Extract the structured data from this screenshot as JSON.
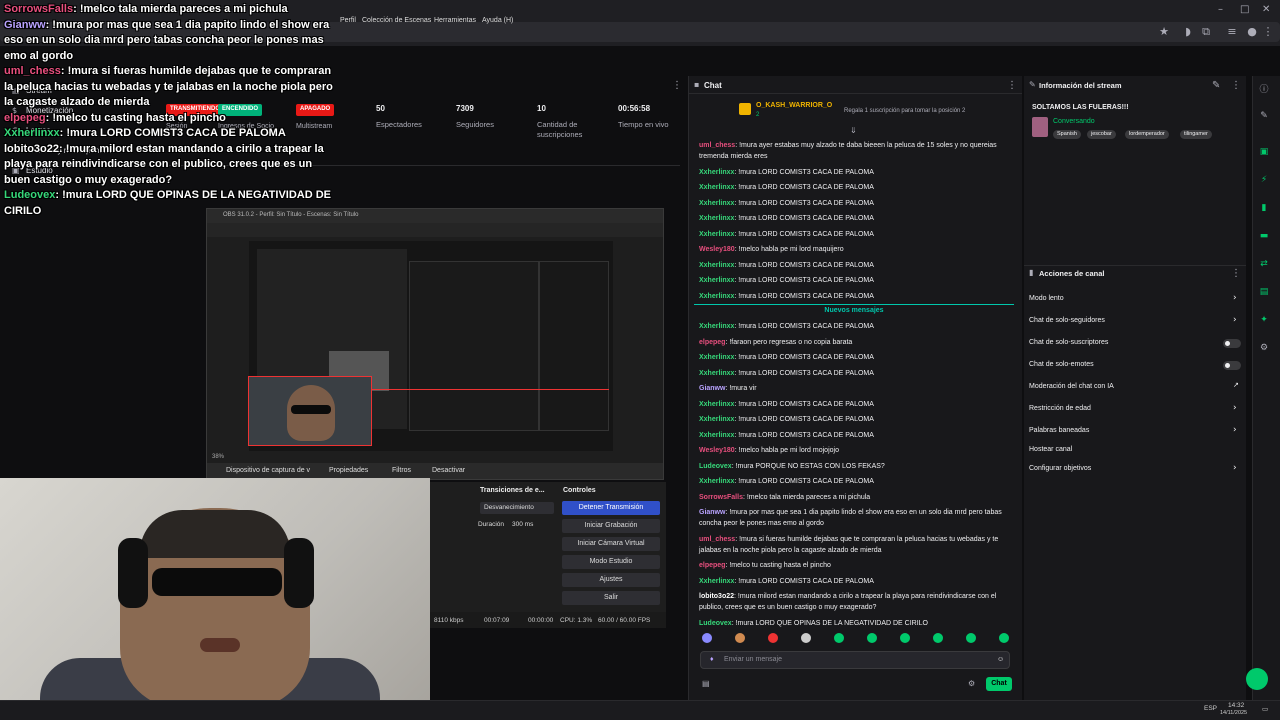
{
  "overlay_chat": [
    {
      "user": "SorrowsFalls",
      "user_color": "#e84f7e",
      "text": "!melco tala mierda pareces a mi pichula"
    },
    {
      "user": "Gianww",
      "user_color": "#b9a3ff",
      "text": "!mura por mas que sea 1 dia papito lindo el show era eso en un solo dia mrd pero tabas concha peor le pones mas emo al gordo"
    },
    {
      "user": "uml_chess",
      "user_color": "#e84f7e",
      "text": "!mura si fueras humilde dejabas que te compraran la peluca hacias tu webadas y te jalabas en la noche piola pero la cagaste alzado de mierda"
    },
    {
      "user": "elpepeg",
      "user_color": "#e84f7e",
      "text": "!melco tu casting hasta el pincho"
    },
    {
      "user": "Xxherlinxx",
      "user_color": "#36d87a",
      "text": "!mura LORD COMIST3 CACA DE PALOMA"
    },
    {
      "user": "lobito3o22",
      "user_color": "#ffffff",
      "text": "!mura milord estan mandando a cirilo a trapear la playa para reindivindicarse con el publico, crees que es un buen castigo o muy exagerado?"
    },
    {
      "user": "Ludeovex",
      "user_color": "#36d87a",
      "text": "!mura LORD QUE OPINAS DE LA NEGATIVIDAD DE CIRILO"
    }
  ],
  "nav": {
    "items": [
      "Stream",
      "Monetización",
      "Logros",
      "Premios y recompensas",
      "Estudio"
    ]
  },
  "status_badges": [
    {
      "label": "TRANSMITIENDO",
      "sub": "Sesión",
      "color": "#e91916"
    },
    {
      "label": "ENCENDIDO",
      "sub": "Ingresos de Socio",
      "color": "#00b37a"
    },
    {
      "label": "APAGADO",
      "sub": "Multistream",
      "color": "#e91916"
    }
  ],
  "stats": [
    {
      "value": "50",
      "label": "Espectadores"
    },
    {
      "value": "7309",
      "label": "Seguidores"
    },
    {
      "value": "10",
      "label": "Cantidad de suscripciones"
    },
    {
      "value": "00:56:58",
      "label": "Tiempo en vivo"
    }
  ],
  "obs": {
    "title": "OBS 31.0.2 - Perfil: Sin Título - Escenas: Sin Título",
    "menu": [
      "Perfil",
      "Colección de Escenas",
      "Herramientas",
      "Ayuda (H)"
    ],
    "zoom": "38%",
    "source_bar": [
      "Dispositivo de captura de v",
      "Propiedades",
      "Filtros",
      "Desactivar"
    ],
    "transitions_title": "Transiciones de e...",
    "transition_type": "Desvanecimiento",
    "duration_label": "Duración",
    "duration_value": "300 ms",
    "controls_title": "Controles",
    "controls": [
      "Detener Transmisión",
      "Iniciar Grabación",
      "Iniciar Cámara Virtual",
      "Modo Estudio",
      "Ajustes",
      "Salir"
    ],
    "status": [
      "8110 kbps",
      "00:07:09",
      "00:00:00",
      "CPU: 1.3%",
      "60.00 / 60.00 FPS"
    ]
  },
  "chat": {
    "title": "Chat",
    "top_gifter": "O_KASH_WARRIOR_O",
    "top_gifter_count": "2",
    "sub_banner": "Regala 1 suscripción para tomar la posición 2",
    "new_messages_label": "Nuevos mensajes",
    "messages_before": [
      {
        "user": "uml_chess",
        "color": "#e84f7e",
        "text": "!mura ayer estabas muy alzado te daba bieeen la peluca de 15 soles y no quereias tremenda mierda eres"
      },
      {
        "user": "Xxherlinxx",
        "color": "#36d87a",
        "text": "!mura LORD COMIST3 CACA DE PALOMA"
      },
      {
        "user": "Xxherlinxx",
        "color": "#36d87a",
        "text": "!mura LORD COMIST3 CACA DE PALOMA"
      },
      {
        "user": "Xxherlinxx",
        "color": "#36d87a",
        "text": "!mura LORD COMIST3 CACA DE PALOMA"
      },
      {
        "user": "Xxherlinxx",
        "color": "#36d87a",
        "text": "!mura LORD COMIST3 CACA DE PALOMA"
      },
      {
        "user": "Xxherlinxx",
        "color": "#36d87a",
        "text": "!mura LORD COMIST3 CACA DE PALOMA"
      },
      {
        "user": "Wesley180",
        "color": "#e84f7e",
        "text": "!melco habla pe mi lord maquijero"
      },
      {
        "user": "Xxherlinxx",
        "color": "#36d87a",
        "text": "!mura LORD COMIST3 CACA DE PALOMA"
      },
      {
        "user": "Xxherlinxx",
        "color": "#36d87a",
        "text": "!mura LORD COMIST3 CACA DE PALOMA"
      },
      {
        "user": "Xxherlinxx",
        "color": "#36d87a",
        "text": "!mura LORD COMIST3 CACA DE PALOMA"
      }
    ],
    "messages_after": [
      {
        "user": "Xxherlinxx",
        "color": "#36d87a",
        "text": "!mura LORD COMIST3 CACA DE PALOMA"
      },
      {
        "user": "elpepeg",
        "color": "#e84f7e",
        "text": "!faraon pero regresas o no copia barata"
      },
      {
        "user": "Xxherlinxx",
        "color": "#36d87a",
        "text": "!mura LORD COMIST3 CACA DE PALOMA"
      },
      {
        "user": "Xxherlinxx",
        "color": "#36d87a",
        "text": "!mura LORD COMIST3 CACA DE PALOMA"
      },
      {
        "user": "Gianww",
        "color": "#b9a3ff",
        "text": "!mura vir"
      },
      {
        "user": "Xxherlinxx",
        "color": "#36d87a",
        "text": "!mura LORD COMIST3 CACA DE PALOMA"
      },
      {
        "user": "Xxherlinxx",
        "color": "#36d87a",
        "text": "!mura LORD COMIST3 CACA DE PALOMA"
      },
      {
        "user": "Xxherlinxx",
        "color": "#36d87a",
        "text": "!mura LORD COMIST3 CACA DE PALOMA"
      },
      {
        "user": "Wesley180",
        "color": "#e84f7e",
        "text": "!melco habla pe mi lord mojojojo"
      },
      {
        "user": "Ludeovex",
        "color": "#36d87a",
        "text": "!mura PORQUE NO ESTAS CON LOS FEKAS?"
      },
      {
        "user": "Xxherlinxx",
        "color": "#36d87a",
        "text": "!mura LORD COMIST3 CACA DE PALOMA"
      },
      {
        "user": "SorrowsFalls",
        "color": "#e84f7e",
        "text": "!melco tala mierda pareces a mi pichula"
      },
      {
        "user": "Gianww",
        "color": "#b9a3ff",
        "text": "!mura por mas que sea 1 dia papito lindo el show era eso en un solo dia mrd pero tabas concha peor le pones mas emo al gordo"
      },
      {
        "user": "uml_chess",
        "color": "#e84f7e",
        "text": "!mura si fueras humilde dejabas que te compraran la peluca hacias tu webadas y te jalabas en la noche piola pero la cagaste alzado de mierda"
      },
      {
        "user": "elpepeg",
        "color": "#e84f7e",
        "text": "!melco tu casting hasta el pincho"
      },
      {
        "user": "Xxherlinxx",
        "color": "#36d87a",
        "text": "!mura LORD COMIST3 CACA DE PALOMA"
      },
      {
        "user": "lobito3o22",
        "color": "#ffffff",
        "text": "!mura milord estan mandando a cirilo a trapear la playa para reindivindicarse con el publico, crees que es un buen castigo o muy exagerado?"
      },
      {
        "user": "Ludeovex",
        "color": "#36d87a",
        "text": "!mura LORD QUE OPINAS DE LA NEGATIVIDAD DE CIRILO"
      }
    ],
    "input_placeholder": "Enviar un mensaje",
    "send_label": "Chat"
  },
  "stream_info": {
    "panel_title": "Información del stream",
    "stream_title": "SOLTAMOS LAS FULERAS!!!",
    "category": "Conversando",
    "tags": [
      "Spanish",
      "jescobar",
      "lordemperador",
      "tilingamer"
    ]
  },
  "channel_actions": {
    "panel_title": "Acciones de canal",
    "items": [
      {
        "label": "Modo lento",
        "control": "arrow"
      },
      {
        "label": "Chat de solo-seguidores",
        "control": "arrow"
      },
      {
        "label": "Chat de solo-suscriptores",
        "control": "toggle"
      },
      {
        "label": "Chat de solo-emotes",
        "control": "toggle"
      },
      {
        "label": "Moderación del chat con IA",
        "control": "external"
      },
      {
        "label": "Restricción de edad",
        "control": "arrow"
      },
      {
        "label": "Palabras baneadas",
        "control": "arrow"
      },
      {
        "label": "Hostear canal",
        "control": "none"
      },
      {
        "label": "Configurar objetivos",
        "control": "arrow"
      }
    ]
  },
  "taskbar": {
    "lang": "ESP",
    "time": "14:32",
    "date": "14/11/2025"
  },
  "colors": {
    "accent": "#00c96b",
    "live_red": "#e91916",
    "chat_bg": "#18181b"
  }
}
